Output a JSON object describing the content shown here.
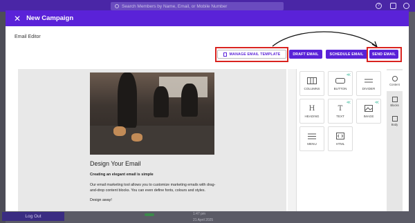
{
  "app": {
    "search_placeholder": "Search Members by Name, Email, or Mobile Number",
    "logout_label": "Log Out",
    "bg_time": "1:47 pm",
    "bg_date": "21 April 2025",
    "help_icon": "help-icon",
    "bell_icon": "bell-icon",
    "profile_icon": "profile-icon"
  },
  "modal": {
    "title": "New Campaign",
    "close_icon": "close-icon",
    "section_label": "Email Editor"
  },
  "toolbar": {
    "manage_template": "MANAGE EMAIL TEMPLATE",
    "draft": "DRAFT EMAIL",
    "schedule": "SCHEDULE EMAIL",
    "send": "SEND EMAIL"
  },
  "email": {
    "heading": "Design Your Email",
    "subheading": "Creating an elegant email is simple",
    "body": "Our email marketing tool allows you to customize marketing emails with drag-and-drop content blocks. You can even define fonts, colours and styles.",
    "closing": "Design away!"
  },
  "blocks": [
    {
      "label": "COLUMNS",
      "icon": "columns-icon"
    },
    {
      "label": "BUTTON",
      "icon": "button-icon"
    },
    {
      "label": "DIVIDER",
      "icon": "divider-icon"
    },
    {
      "label": "HEADING",
      "icon": "heading-icon"
    },
    {
      "label": "TEXT",
      "icon": "text-icon"
    },
    {
      "label": "IMAGE",
      "icon": "image-icon"
    },
    {
      "label": "MENU",
      "icon": "menu-icon"
    },
    {
      "label": "HTML",
      "icon": "html-icon"
    }
  ],
  "side_tabs": [
    {
      "label": "Content",
      "icon": "content-icon"
    },
    {
      "label": "Blocks",
      "icon": "blocks-icon"
    },
    {
      "label": "Body",
      "icon": "body-icon"
    }
  ],
  "colors": {
    "accent": "#5a22d8",
    "highlight": "#d9231f",
    "tag": "#4cbfa3"
  }
}
